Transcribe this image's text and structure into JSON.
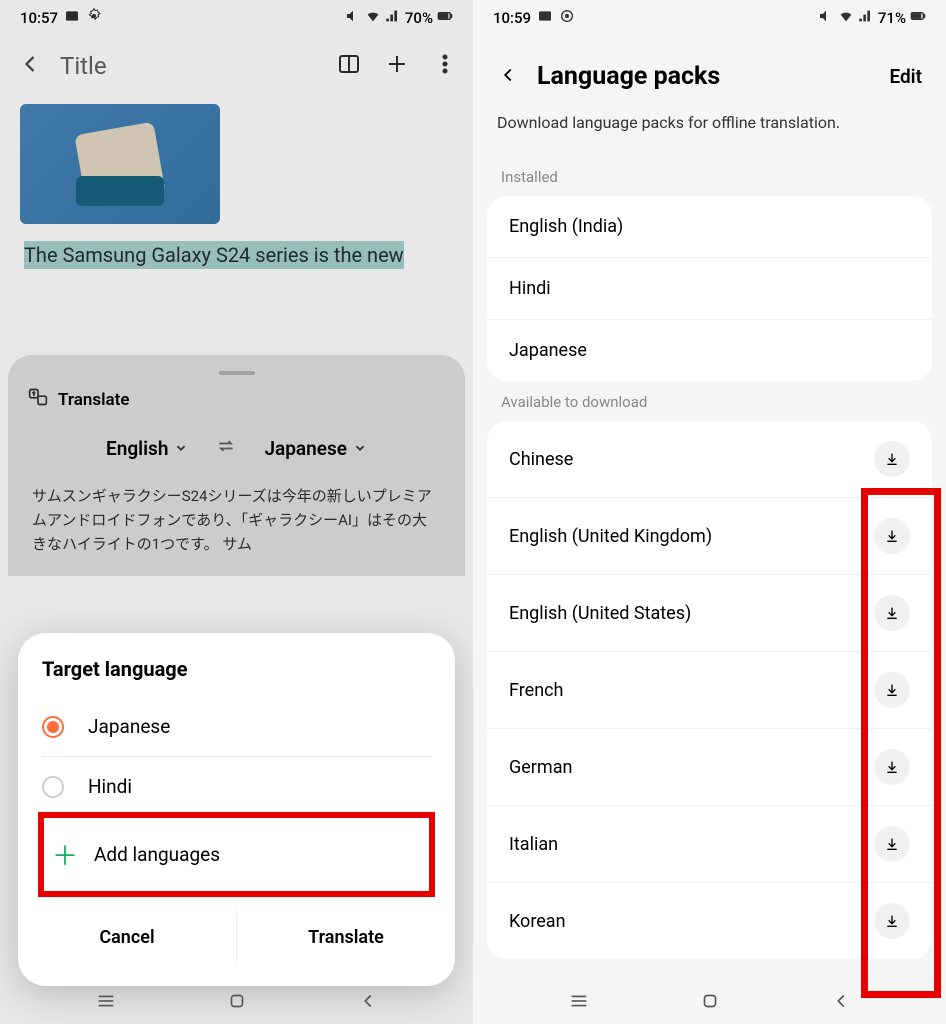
{
  "left": {
    "status": {
      "time": "10:57",
      "battery": "70%"
    },
    "header": {
      "title": "Title"
    },
    "body_text": "The Samsung Galaxy S24 series is the new",
    "sheet": {
      "title": "Translate",
      "source": "English",
      "target": "Japanese",
      "translated": "サムスンギャラクシーS24シリーズは今年の新しいプレミアムアンドロイドフォンであり、「ギャラクシーAI」はその大きなハイライトの1つです。 サム"
    },
    "modal": {
      "title": "Target language",
      "selected": "Japanese",
      "option2": "Hindi",
      "add": "Add languages",
      "cancel": "Cancel",
      "translate": "Translate"
    }
  },
  "right": {
    "status": {
      "time": "10:59",
      "battery": "71%"
    },
    "header": {
      "title": "Language packs",
      "edit": "Edit"
    },
    "subtitle": "Download language packs for offline translation.",
    "installed_label": "Installed",
    "installed": [
      "English (India)",
      "Hindi",
      "Japanese"
    ],
    "available_label": "Available to download",
    "available": [
      "Chinese",
      "English (United Kingdom)",
      "English (United States)",
      "French",
      "German",
      "Italian",
      "Korean"
    ]
  }
}
